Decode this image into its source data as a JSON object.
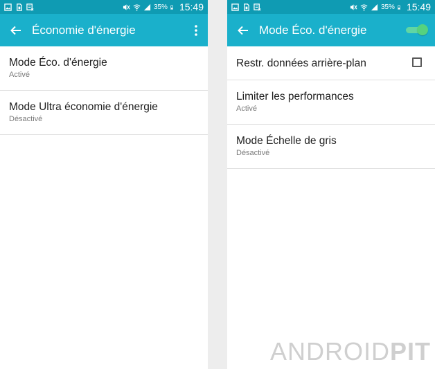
{
  "colors": {
    "statusbar": "#0f9bb3",
    "appbar": "#1ab0cb",
    "toggle_on": "#55d27f",
    "divider": "#dedede",
    "background": "#ededed"
  },
  "statusbar": {
    "left_icons": [
      "image-icon",
      "sim-icon",
      "data-saver-icon"
    ],
    "right_icons": [
      "mute-icon",
      "wifi-icon",
      "signal-icon",
      "battery-icon"
    ],
    "battery": "35%",
    "time": "15:49"
  },
  "left": {
    "title": "Économie d'énergie",
    "items": [
      {
        "title": "Mode Éco. d'énergie",
        "subtitle": "Activé"
      },
      {
        "title": "Mode Ultra économie d'énergie",
        "subtitle": "Désactivé"
      }
    ]
  },
  "right": {
    "title": "Mode Éco. d'énergie",
    "toggle": {
      "state": "on"
    },
    "items": [
      {
        "title": "Restr. données arrière-plan",
        "checked": false
      },
      {
        "title": "Limiter les performances",
        "subtitle": "Activé"
      },
      {
        "title": "Mode Échelle de gris",
        "subtitle": "Désactivé"
      }
    ]
  },
  "watermark": {
    "light": "ANDROID",
    "bold": "PIT"
  }
}
